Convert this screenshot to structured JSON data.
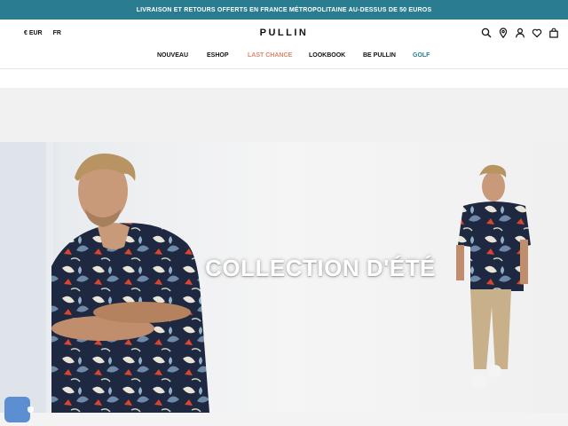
{
  "promo": {
    "text": "LIVRAISON ET RETOURS OFFERTS EN FRANCE MÉTROPOLITAINE AU-DESSUS DE 50 EUROS"
  },
  "header": {
    "currency": "€ EUR",
    "language": "FR",
    "logo": "PULLIN",
    "icons": [
      "search-icon",
      "location-pin-icon",
      "account-icon",
      "heart-icon",
      "shopping-bag-icon"
    ]
  },
  "nav": {
    "items": [
      {
        "label": "NOUVEAU"
      },
      {
        "label": "ESHOP"
      },
      {
        "label": "LAST CHANCE",
        "color": "#e0876a"
      },
      {
        "label": "LOOKBOOK"
      },
      {
        "label": "BE PULLIN"
      },
      {
        "label": "GOLF",
        "color": "#2a7d90"
      }
    ]
  },
  "hero": {
    "title": "COLLECTION D'ÉTÉ"
  },
  "colors": {
    "promo_bg": "#2a7d90",
    "accent": "#e0876a",
    "chat": "#5b8fd1"
  }
}
